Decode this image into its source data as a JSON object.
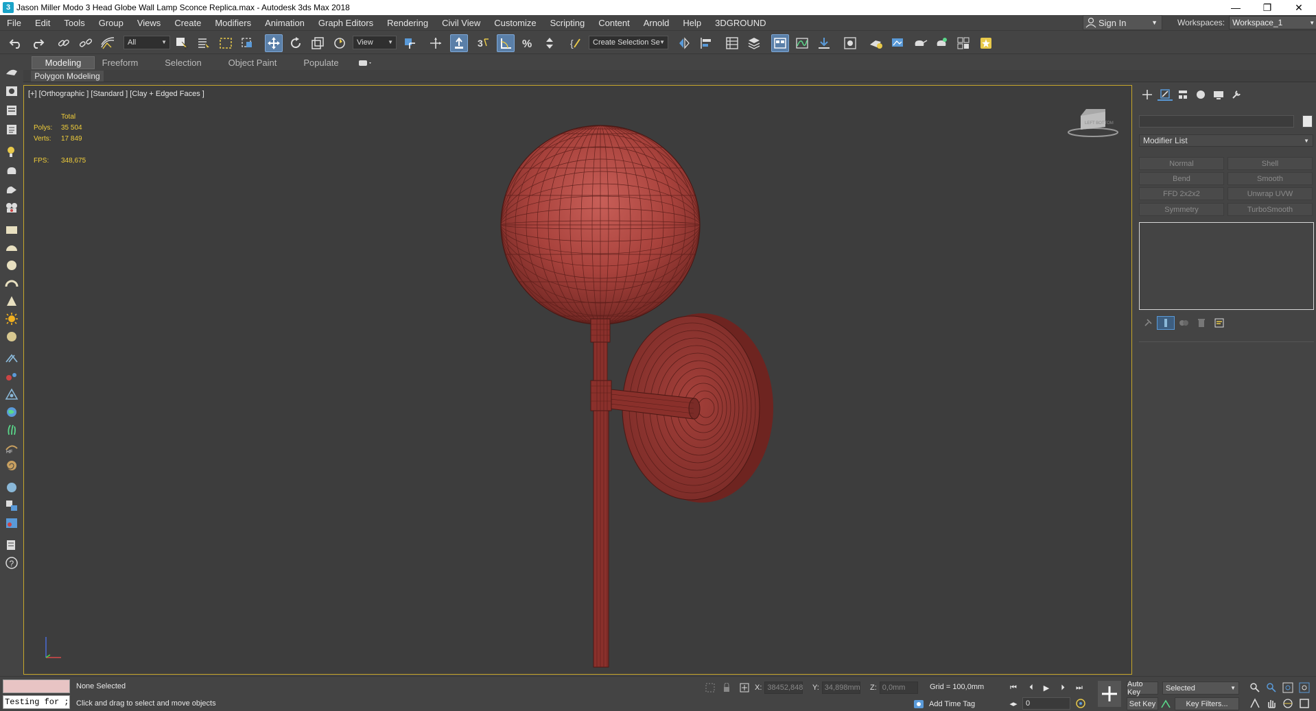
{
  "titlebar": {
    "logo": "3",
    "title": "Jason Miller Modo 3 Head Globe Wall Lamp Sconce Replica.max - Autodesk 3ds Max 2018",
    "minimize": "—",
    "restore": "❐",
    "close": "✕"
  },
  "menu": {
    "items": [
      "File",
      "Edit",
      "Tools",
      "Group",
      "Views",
      "Create",
      "Modifiers",
      "Animation",
      "Graph Editors",
      "Rendering",
      "Civil View",
      "Customize",
      "Scripting",
      "Content",
      "Arnold",
      "Help",
      "3DGROUND"
    ],
    "signin": "Sign In",
    "workspaces_label": "Workspaces:",
    "workspace_value": "Workspace_1"
  },
  "toolbar": {
    "selection_filter": "All",
    "ref_coord": "View",
    "named_selection": "Create Selection Se"
  },
  "ribbon": {
    "tabs": [
      "Modeling",
      "Freeform",
      "Selection",
      "Object Paint",
      "Populate"
    ],
    "panel": "Polygon Modeling"
  },
  "viewport": {
    "label": "[+] [Orthographic ] [Standard ] [Clay + Edged Faces ]",
    "stats": {
      "total": "Total",
      "polys_label": "Polys:",
      "polys": "35 504",
      "verts_label": "Verts:",
      "verts": "17 849",
      "fps_label": "FPS:",
      "fps": "348,675"
    },
    "viewcube_label": "LEFT  BOTTOM"
  },
  "command_panel": {
    "modifier_list": "Modifier List",
    "buttons": [
      "Normal",
      "Shell",
      "Bend",
      "Smooth",
      "FFD 2x2x2",
      "Unwrap UVW",
      "Symmetry",
      "TurboSmooth"
    ]
  },
  "status": {
    "maxscript_listener": "Testing for ;",
    "selection": "None Selected",
    "prompt": "Click and drag to select and move objects",
    "x_label": "X:",
    "x": "38452,848",
    "y_label": "Y:",
    "y": "34,898mm",
    "z_label": "Z:",
    "z": "0,0mm",
    "grid": "Grid = 100,0mm",
    "add_time_tag": "Add Time Tag",
    "auto_key": "Auto Key",
    "set_key": "Set Key",
    "selected": "Selected",
    "key_filters": "Key Filters...",
    "frame": "0"
  },
  "colors": {
    "accent": "#5a7fa8",
    "viewport_border": "#c8a82b",
    "stats": "#f2cf3a",
    "model": "#9a3a36"
  }
}
